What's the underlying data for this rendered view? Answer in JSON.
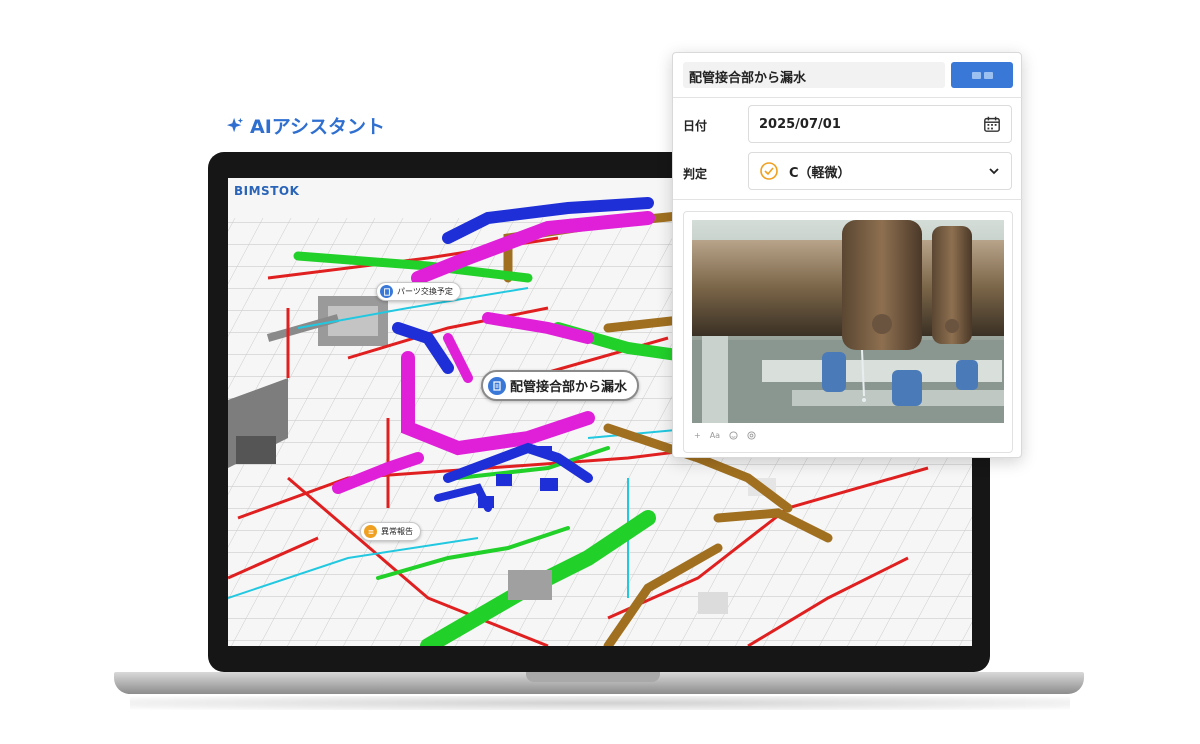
{
  "assistant": {
    "label": "AIアシスタント"
  },
  "app": {
    "brand": "BIMSTOK"
  },
  "model_tags": {
    "parts_replacement": "パーツ交換予定",
    "leak": "配管接合部から漏水",
    "anomaly_report": "異常報告"
  },
  "panel": {
    "title": "配管接合部から漏水",
    "date_label": "日付",
    "date_value": "2025/07/01",
    "rating_label": "判定",
    "rating_value": "C（軽微）",
    "toolbar": {
      "add": "+",
      "font": "Aa"
    }
  },
  "colors": {
    "accent": "#3a78d8",
    "rating_badge": "#f0a020",
    "pipe_magenta": "#e020d8",
    "pipe_blue": "#1e2fd8",
    "pipe_green": "#22d02a",
    "pipe_red": "#e02020",
    "pipe_brown": "#a07020",
    "pipe_cyan": "#22c8e0"
  }
}
